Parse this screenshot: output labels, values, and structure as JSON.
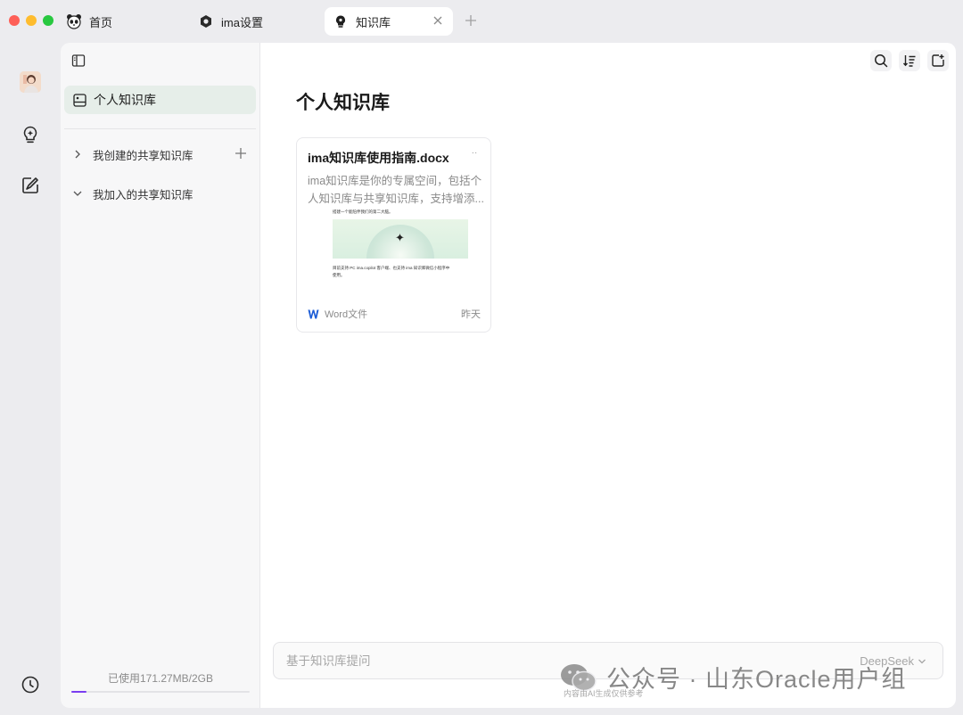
{
  "window": {
    "tabs": [
      {
        "label": "首页",
        "icon": "panda-icon"
      },
      {
        "label": "ima设置",
        "icon": "settings-icon"
      },
      {
        "label": "知识库",
        "icon": "knowledge-bulb-icon",
        "active": true
      }
    ]
  },
  "rail": {
    "items": [
      "avatar",
      "knowledge-bulb-icon",
      "note-edit-icon",
      "history-clock-icon"
    ]
  },
  "sidebar": {
    "active_item": "个人知识库",
    "groups": [
      {
        "label": "我创建的共享知识库",
        "expanded": false
      },
      {
        "label": "我加入的共享知识库",
        "expanded": true
      }
    ],
    "storage": {
      "label": "已使用171.27MB/2GB",
      "used_fraction": 0.084
    }
  },
  "main": {
    "title": "个人知识库",
    "card": {
      "title": "ima知识库使用指南.docx",
      "desc_line1": "ima知识库是你的专属空间，包括个",
      "desc_line2": "人知识库与共享知识库，支持增添...",
      "preview_line1": "搭建一个能陪伴我们的第二大脑。",
      "preview_line2": "目前支持 PC ima.copilot 客户端、也支持 ima 知识库微信小程序中",
      "preview_line3": "使用。",
      "file_type": "Word文件",
      "time": "昨天",
      "more": "··"
    },
    "ask": {
      "placeholder": "基于知识库提问",
      "model": "DeepSeek"
    }
  },
  "watermark": {
    "text": "公众号 · 山东Oracle用户组",
    "note": "内容由AI生成仅供参考"
  },
  "colors": {
    "active_item_bg": "#e6eee9",
    "storage_fill": "#7a3df0",
    "word_blue": "#1a5bd6"
  }
}
